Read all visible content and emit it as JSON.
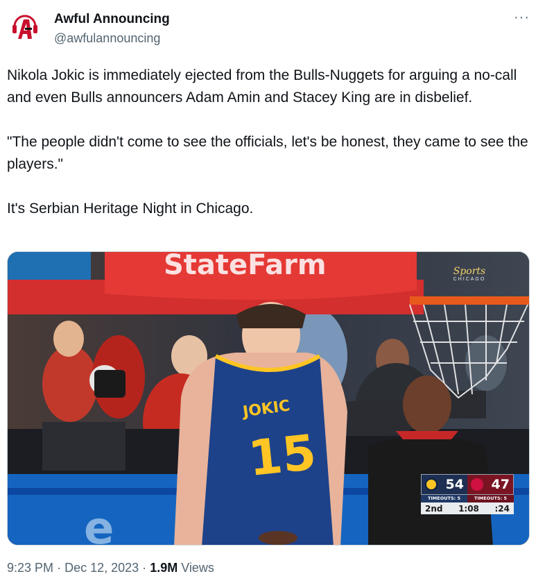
{
  "author": {
    "display_name": "Awful Announcing",
    "handle": "@awfulannouncing",
    "avatar_icon": "awful-announcing-logo-icon",
    "avatar_color": "#c8102e"
  },
  "more_icon": "more-icon",
  "more_glyph": "···",
  "tweet": {
    "paragraphs": [
      "Nikola Jokic is immediately ejected from the Bulls-Nuggets for arguing a no-call and even Bulls announcers Adam Amin and Stacey King are in disbelief.",
      "\"The people didn't come to see the officials, let's be honest, they came to see the players.\"",
      "It's Serbian Heritage Night in Chicago."
    ]
  },
  "media": {
    "jersey_name": "JOKIC",
    "jersey_number": "15",
    "sponsor_text": "StateFarm",
    "broadcaster_brand": "Sports",
    "broadcaster_city": "CHICAGO",
    "scorebug": {
      "home_score": "54",
      "away_score": "47",
      "home_timeouts": "TIMEOUTS: 5",
      "away_timeouts": "TIMEOUTS: 5",
      "quarter": "2nd",
      "clock": "1:08",
      "shot_clock": ":24"
    },
    "colors": {
      "nuggets_blue": "#1d428a",
      "nuggets_gold": "#fec524",
      "bulls_red": "#ce1141",
      "rim_orange": "#e8591c"
    }
  },
  "footer": {
    "time": "9:23 PM",
    "separator": "·",
    "date": "Dec 12, 2023",
    "views_count": "1.9M",
    "views_label": "Views"
  }
}
